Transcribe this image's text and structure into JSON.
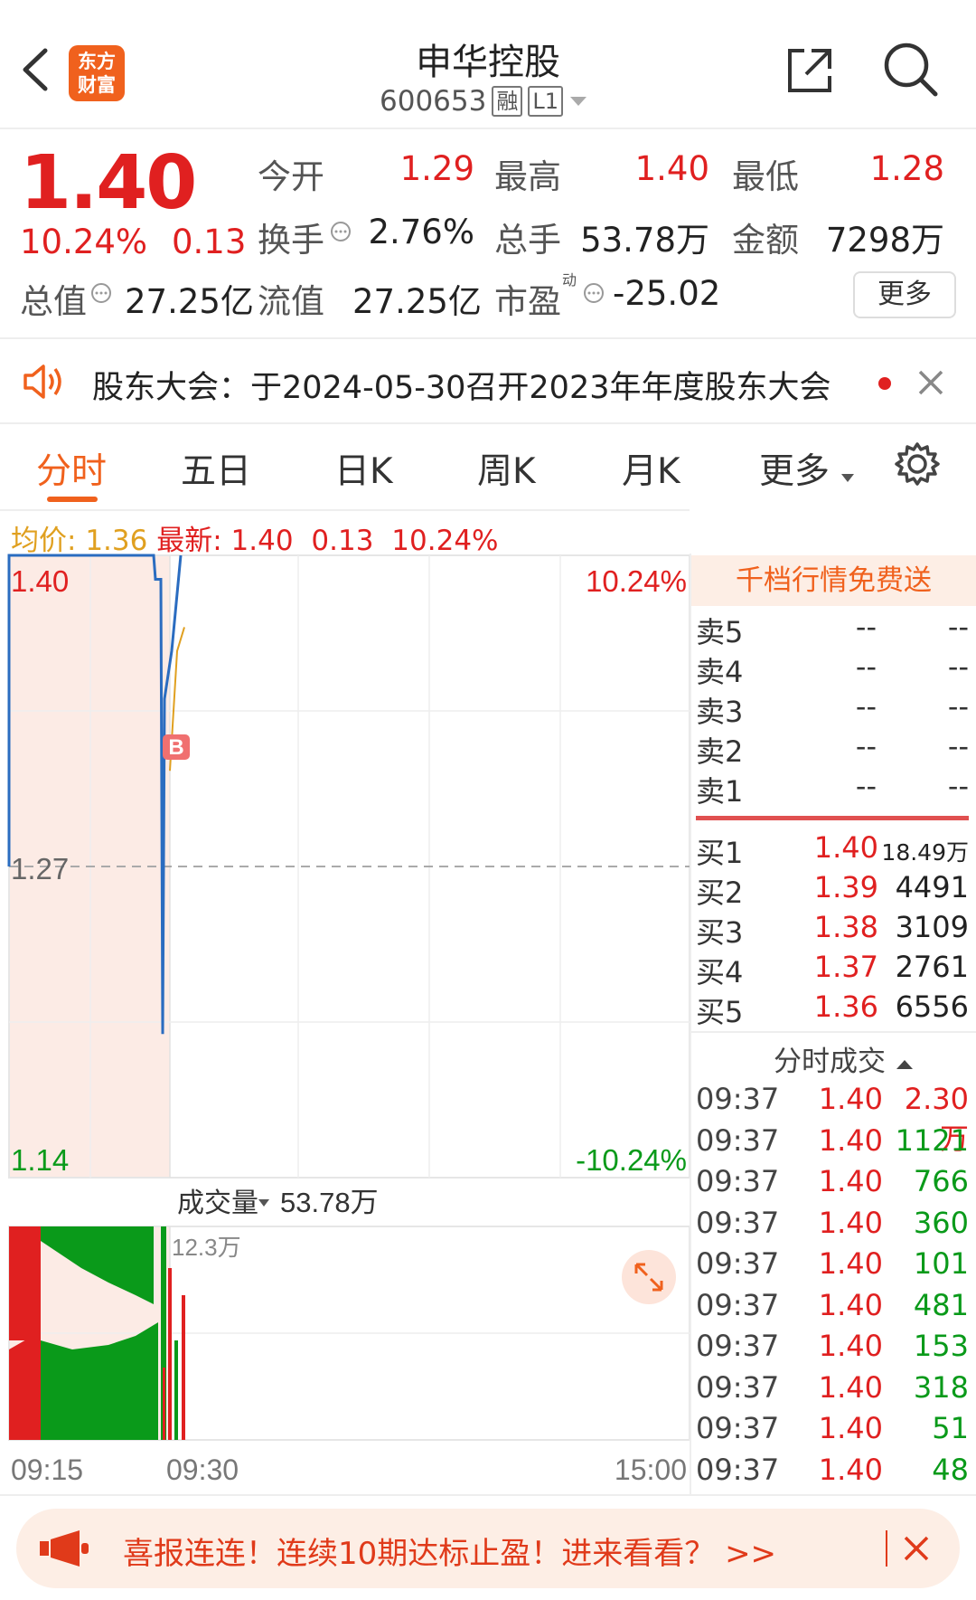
{
  "header": {
    "logo_text_1": "东方",
    "logo_text_2": "财富",
    "title": "申华控股",
    "code": "600653",
    "tag_margin": "融",
    "tag_level": "L1"
  },
  "quote": {
    "price": "1.40",
    "change_pct": "10.24%",
    "change": "0.13",
    "open_label": "今开",
    "open": "1.29",
    "high_label": "最高",
    "high": "1.40",
    "low_label": "最低",
    "low": "1.28",
    "turnover_label": "换手",
    "turnover": "2.76%",
    "volume_label": "总手",
    "volume": "53.78万",
    "amount_label": "金额",
    "amount": "7298万",
    "mktcap_label": "总值",
    "mktcap": "27.25亿",
    "float_label": "流值",
    "float_cap": "27.25亿",
    "pe_label": "市盈",
    "pe_sup": "动",
    "pe": "-25.02",
    "more_label": "更多"
  },
  "notice": {
    "text": "股东大会：于2024-05-30召开2023年年度股东大会"
  },
  "tabs": [
    {
      "label": "分时",
      "active": true
    },
    {
      "label": "五日"
    },
    {
      "label": "日K"
    },
    {
      "label": "周K"
    },
    {
      "label": "月K"
    },
    {
      "label": "更多"
    }
  ],
  "chart_info": {
    "avg_label": "均价:",
    "avg": "1.36",
    "latest_label": "最新:",
    "latest": "1.40",
    "change": "0.13",
    "change_pct": "10.24%"
  },
  "chart_data": {
    "type": "line",
    "y_left_ticks": [
      "1.40",
      "1.27",
      "1.14"
    ],
    "y_right_ticks": [
      "10.24%",
      "-10.24%"
    ],
    "x_ticks": [
      "09:15",
      "09:30",
      "15:00"
    ],
    "ylim": [
      1.14,
      1.4
    ],
    "prev_close": 1.27,
    "series": [
      {
        "values": [
          1.4,
          1.4,
          1.39,
          1.39,
          1.2,
          1.34,
          1.35,
          1.36,
          1.4
        ]
      }
    ],
    "b_marker": "B",
    "volume_label": "成交量",
    "volume_total": "53.78万",
    "volume_max": "12.3万"
  },
  "orderbook": {
    "promo": "千档行情免费送",
    "asks": [
      {
        "label": "卖5",
        "price": "--",
        "vol": "--"
      },
      {
        "label": "卖4",
        "price": "--",
        "vol": "--"
      },
      {
        "label": "卖3",
        "price": "--",
        "vol": "--"
      },
      {
        "label": "卖2",
        "price": "--",
        "vol": "--"
      },
      {
        "label": "卖1",
        "price": "--",
        "vol": "--"
      }
    ],
    "bids": [
      {
        "label": "买1",
        "price": "1.40",
        "vol": "18.49万"
      },
      {
        "label": "买2",
        "price": "1.39",
        "vol": "4491"
      },
      {
        "label": "买3",
        "price": "1.38",
        "vol": "3109"
      },
      {
        "label": "买4",
        "price": "1.37",
        "vol": "2761"
      },
      {
        "label": "买5",
        "price": "1.36",
        "vol": "6556"
      }
    ],
    "ticks_title": "分时成交",
    "ticks": [
      {
        "time": "09:37",
        "price": "1.40",
        "vol": "2.30万",
        "color": "red"
      },
      {
        "time": "09:37",
        "price": "1.40",
        "vol": "1121",
        "color": "green"
      },
      {
        "time": "09:37",
        "price": "1.40",
        "vol": "766",
        "color": "green"
      },
      {
        "time": "09:37",
        "price": "1.40",
        "vol": "360",
        "color": "green"
      },
      {
        "time": "09:37",
        "price": "1.40",
        "vol": "101",
        "color": "green"
      },
      {
        "time": "09:37",
        "price": "1.40",
        "vol": "481",
        "color": "green"
      },
      {
        "time": "09:37",
        "price": "1.40",
        "vol": "153",
        "color": "green"
      },
      {
        "time": "09:37",
        "price": "1.40",
        "vol": "318",
        "color": "green"
      },
      {
        "time": "09:37",
        "price": "1.40",
        "vol": "51",
        "color": "green"
      },
      {
        "time": "09:37",
        "price": "1.40",
        "vol": "48",
        "color": "green"
      }
    ]
  },
  "banner": {
    "text": "喜报连连！连续10期达标止盈！进来看看？ >>"
  }
}
